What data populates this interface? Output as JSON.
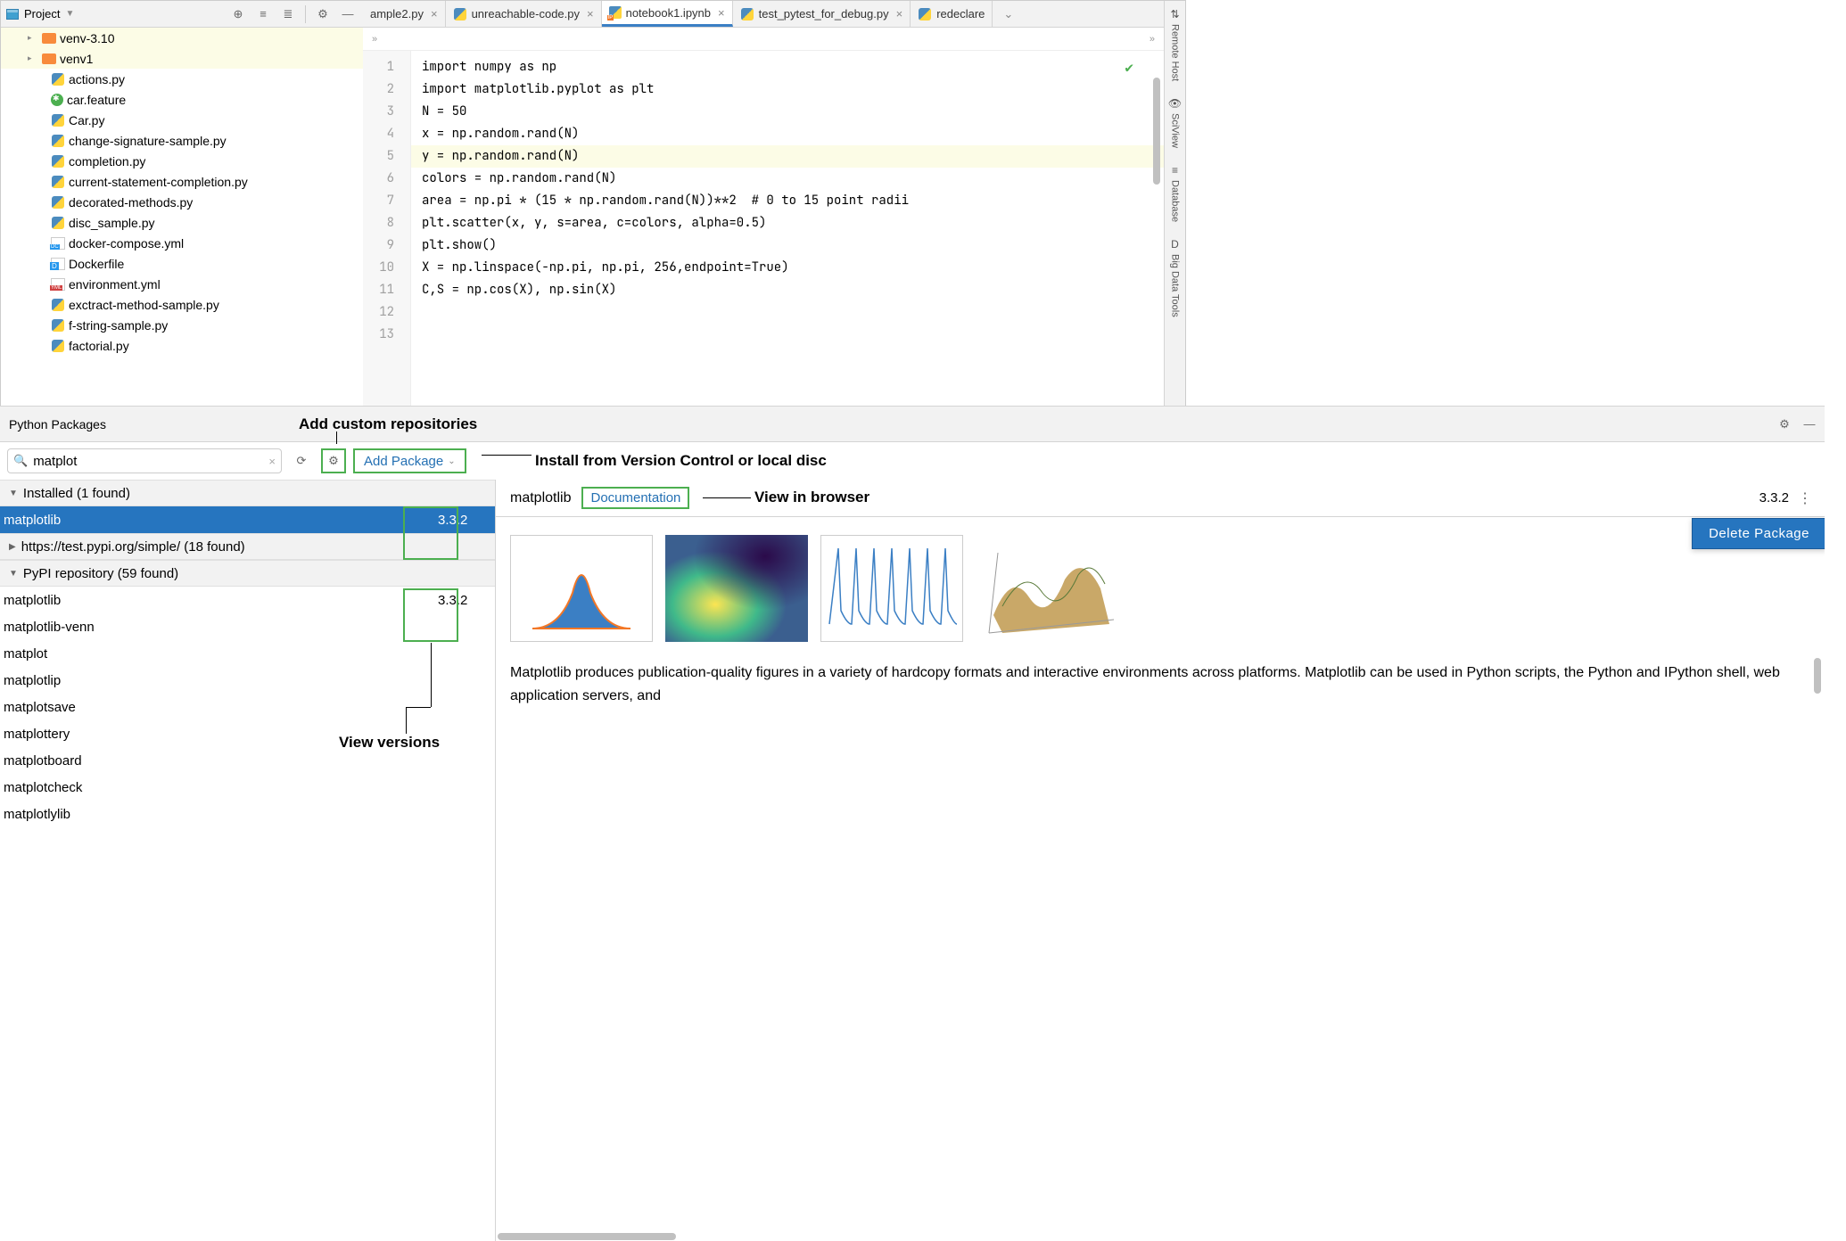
{
  "project_panel": {
    "label": "Project",
    "tree": {
      "folders": [
        "venv-3.10",
        "venv1"
      ],
      "files": [
        {
          "name": "actions.py",
          "icon": "py"
        },
        {
          "name": "car.feature",
          "icon": "feat"
        },
        {
          "name": "Car.py",
          "icon": "py"
        },
        {
          "name": "change-signature-sample.py",
          "icon": "py"
        },
        {
          "name": "completion.py",
          "icon": "py"
        },
        {
          "name": "current-statement-completion.py",
          "icon": "py"
        },
        {
          "name": "decorated-methods.py",
          "icon": "py"
        },
        {
          "name": "disc_sample.py",
          "icon": "py"
        },
        {
          "name": "docker-compose.yml",
          "icon": "dcomp"
        },
        {
          "name": "Dockerfile",
          "icon": "docker"
        },
        {
          "name": "environment.yml",
          "icon": "yml"
        },
        {
          "name": "exctract-method-sample.py",
          "icon": "py"
        },
        {
          "name": "f-string-sample.py",
          "icon": "py"
        },
        {
          "name": "factorial.py",
          "icon": "py"
        }
      ]
    }
  },
  "tabs": [
    {
      "label": "ample2.py",
      "icon": "py",
      "active": false,
      "partial": true
    },
    {
      "label": "unreachable-code.py",
      "icon": "py",
      "active": false
    },
    {
      "label": "notebook1.ipynb",
      "icon": "nb",
      "active": true
    },
    {
      "label": "test_pytest_for_debug.py",
      "icon": "py",
      "active": false
    },
    {
      "label": "redeclare",
      "icon": "py",
      "active": false,
      "partial_end": true
    }
  ],
  "breadcrumb_toggle": "»",
  "editor": {
    "lines": [
      "import numpy as np",
      "import matplotlib.pyplot as plt",
      "N = 50",
      "x = np.random.rand(N)",
      "y = np.random.rand(N)",
      "colors = np.random.rand(N)",
      "area = np.pi * (15 * np.random.rand(N))**2  # 0 to 15 point radii",
      "plt.scatter(x, y, s=area, c=colors, alpha=0.5)",
      "plt.show()",
      "",
      "X = np.linspace(-np.pi, np.pi, 256,endpoint=True)",
      "C,S = np.cos(X), np.sin(X)",
      ""
    ],
    "highlight_line": 5
  },
  "sidebar_tools": [
    "Remote Host",
    "SciView",
    "Database",
    "Big Data Tools"
  ],
  "packages": {
    "title": "Python Packages",
    "search_value": "matplot",
    "add_package_label": "Add Package",
    "annotations": {
      "repos": "Add custom repositories",
      "install": "Install from Version Control or local disc",
      "versions": "View versions",
      "browser": "View in browser"
    },
    "sections": [
      {
        "label": "Installed (1 found)",
        "expanded": true,
        "items": [
          {
            "name": "matplotlib",
            "version": "3.3.2",
            "selected": true
          }
        ]
      },
      {
        "label": "https://test.pypi.org/simple/ (18 found)",
        "expanded": false,
        "items": []
      },
      {
        "label": "PyPI repository (59 found)",
        "expanded": true,
        "items": [
          {
            "name": "matplotlib",
            "version": "3.3.2"
          },
          {
            "name": "matplotlib-venn",
            "version": ""
          },
          {
            "name": "matplot",
            "version": ""
          },
          {
            "name": "matplotlip",
            "version": ""
          },
          {
            "name": "matplotsave",
            "version": ""
          },
          {
            "name": "matplottery",
            "version": ""
          },
          {
            "name": "matplotboard",
            "version": ""
          },
          {
            "name": "matplotcheck",
            "version": ""
          },
          {
            "name": "matplotlylib",
            "version": ""
          }
        ]
      }
    ],
    "detail": {
      "name": "matplotlib",
      "doc_link": "Documentation",
      "version": "3.3.2",
      "popup": "Delete Package",
      "description": "Matplotlib produces publication-quality figures in a variety of hardcopy formats and interactive environments across platforms. Matplotlib can be used in Python scripts, the Python and IPython shell, web application servers, and "
    }
  }
}
